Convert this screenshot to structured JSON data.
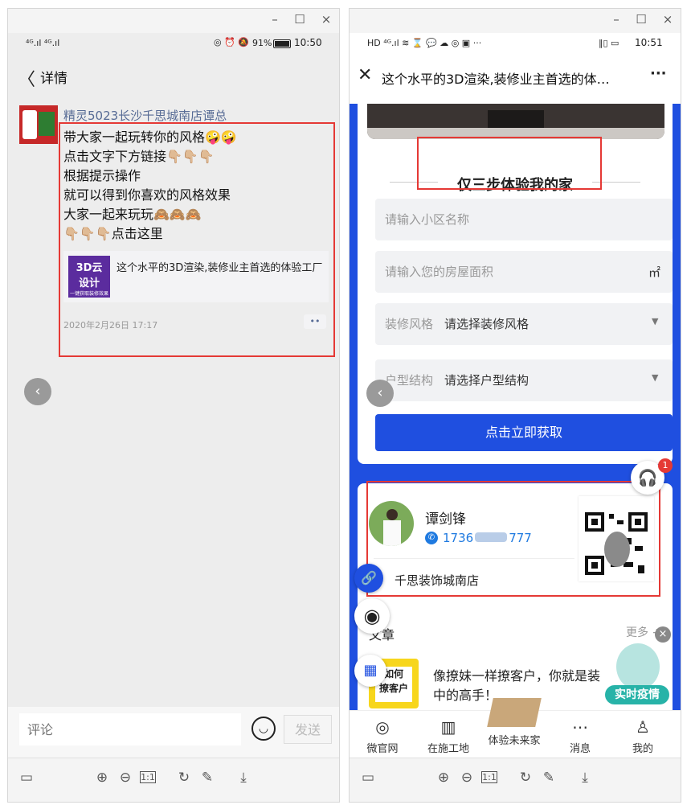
{
  "left": {
    "status": {
      "signal": "⁴ᴳ.ıl ⁴ᴳ.ıl",
      "icons_right": "◎ ⏰ 🔕",
      "battery": "91%",
      "time": "10:50"
    },
    "nav": {
      "title": "详情"
    },
    "post": {
      "author": "精灵5023长沙千思城南店谭总",
      "lines": [
        "带大家一起玩转你的风格🤪🤪",
        "点击文字下方链接👇🏼👇🏼👇🏼",
        "根据提示操作",
        "就可以得到你喜欢的风格效果",
        "大家一起来玩玩🙈🙈🙈",
        "👇🏼👇🏼👇🏼点击这里"
      ],
      "link": {
        "thumb_line1": "3D云",
        "thumb_line2": "设计",
        "thumb_line3": "一键获取装修效果",
        "title": "这个水平的3D渲染,装修业主首选的体验工厂"
      },
      "timestamp": "2020年2月26日 17:17",
      "more": "••"
    },
    "comment": {
      "placeholder": "评论",
      "send": "发送"
    }
  },
  "right": {
    "status": {
      "left_icons": "HD ⁴ᴳ.ıl ≋ ⌛ 💬 ☁ ◎ ▣ ···",
      "right_icons": "‖▯ ▭",
      "time": "10:51"
    },
    "nav": {
      "title": "这个水平的3D渲染,装修业主首选的体…",
      "menu": "···"
    },
    "form": {
      "heading": "仅三步体验我的家",
      "community_placeholder": "请输入小区名称",
      "area_placeholder": "请输入您的房屋面积",
      "area_unit": "㎡",
      "style_label": "装修风格",
      "style_value": "请选择装修风格",
      "structure_label": "户型结构",
      "structure_value": "请选择户型结构",
      "submit": "点击立即获取"
    },
    "badge_count": "1",
    "card": {
      "name": "谭剑锋",
      "phone_start": "1736",
      "phone_end": "777",
      "store": "千思装饰城南店"
    },
    "articles": {
      "title": "文章",
      "more": "更多 +"
    },
    "article": {
      "thumb_line1": "如何",
      "thumb_line2": "撩客户",
      "text_line1": "像撩妹一样撩客户，你就是装",
      "text_line2": "中的高手！"
    },
    "epidemic": "实时疫情",
    "tabs": [
      "微官网",
      "在施工地",
      "体验未来家",
      "消息",
      "我的"
    ]
  },
  "colors": {
    "primary_blue": "#1f4fe0",
    "highlight_red": "#e53935",
    "author_blue": "#576b95"
  }
}
